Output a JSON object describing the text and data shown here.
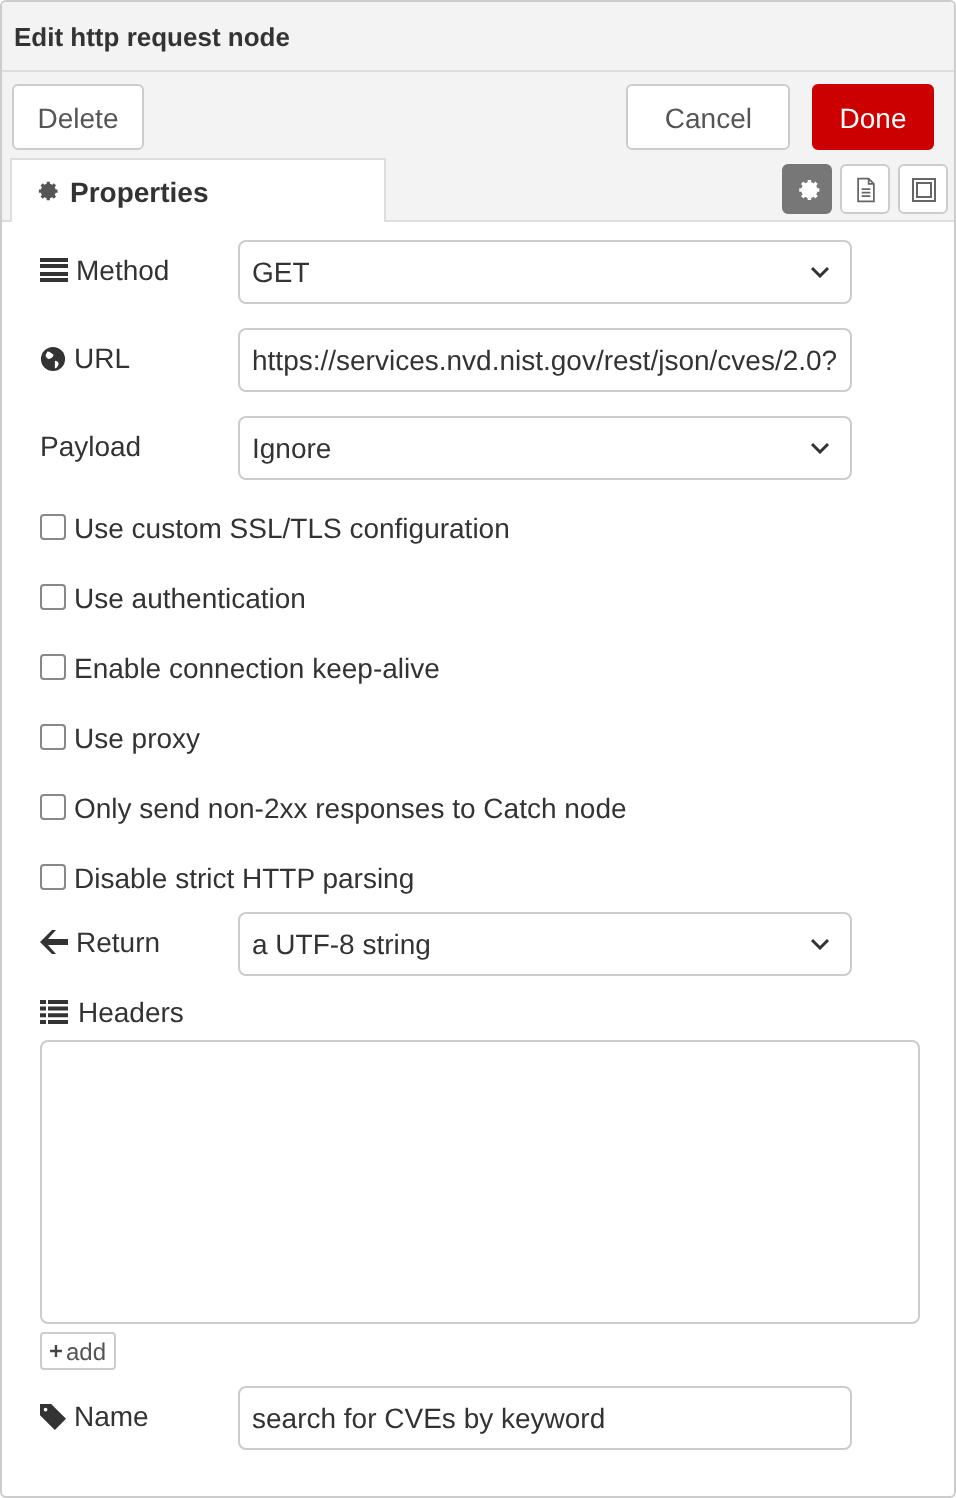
{
  "window": {
    "title": "Edit http request node"
  },
  "toolbar": {
    "delete": "Delete",
    "cancel": "Cancel",
    "done": "Done"
  },
  "tabs": [
    {
      "label": "Properties",
      "selected": true
    }
  ],
  "tab_buttons": [
    {
      "selected": true
    },
    {
      "selected": false
    },
    {
      "selected": false
    }
  ],
  "method": {
    "label": "Method",
    "value": "GET"
  },
  "url": {
    "label": "URL",
    "value": "https://services.nvd.nist.gov/rest/json/cves/2.0?"
  },
  "payload": {
    "label": "Payload",
    "value": "Ignore"
  },
  "options": [
    {
      "label": "Use custom SSL/TLS configuration",
      "checked": false
    },
    {
      "label": "Use authentication",
      "checked": false
    },
    {
      "label": "Enable connection keep-alive",
      "checked": false
    },
    {
      "label": "Use proxy",
      "checked": false
    },
    {
      "label": "Only send non-2xx responses to Catch node",
      "checked": false
    },
    {
      "label": "Disable strict HTTP parsing",
      "checked": false
    }
  ],
  "return": {
    "label": "Return",
    "value": "a UTF-8 string"
  },
  "headers": {
    "label": "Headers",
    "add_button": "add"
  },
  "name": {
    "label": "Name",
    "value": "search for CVEs by keyword"
  }
}
